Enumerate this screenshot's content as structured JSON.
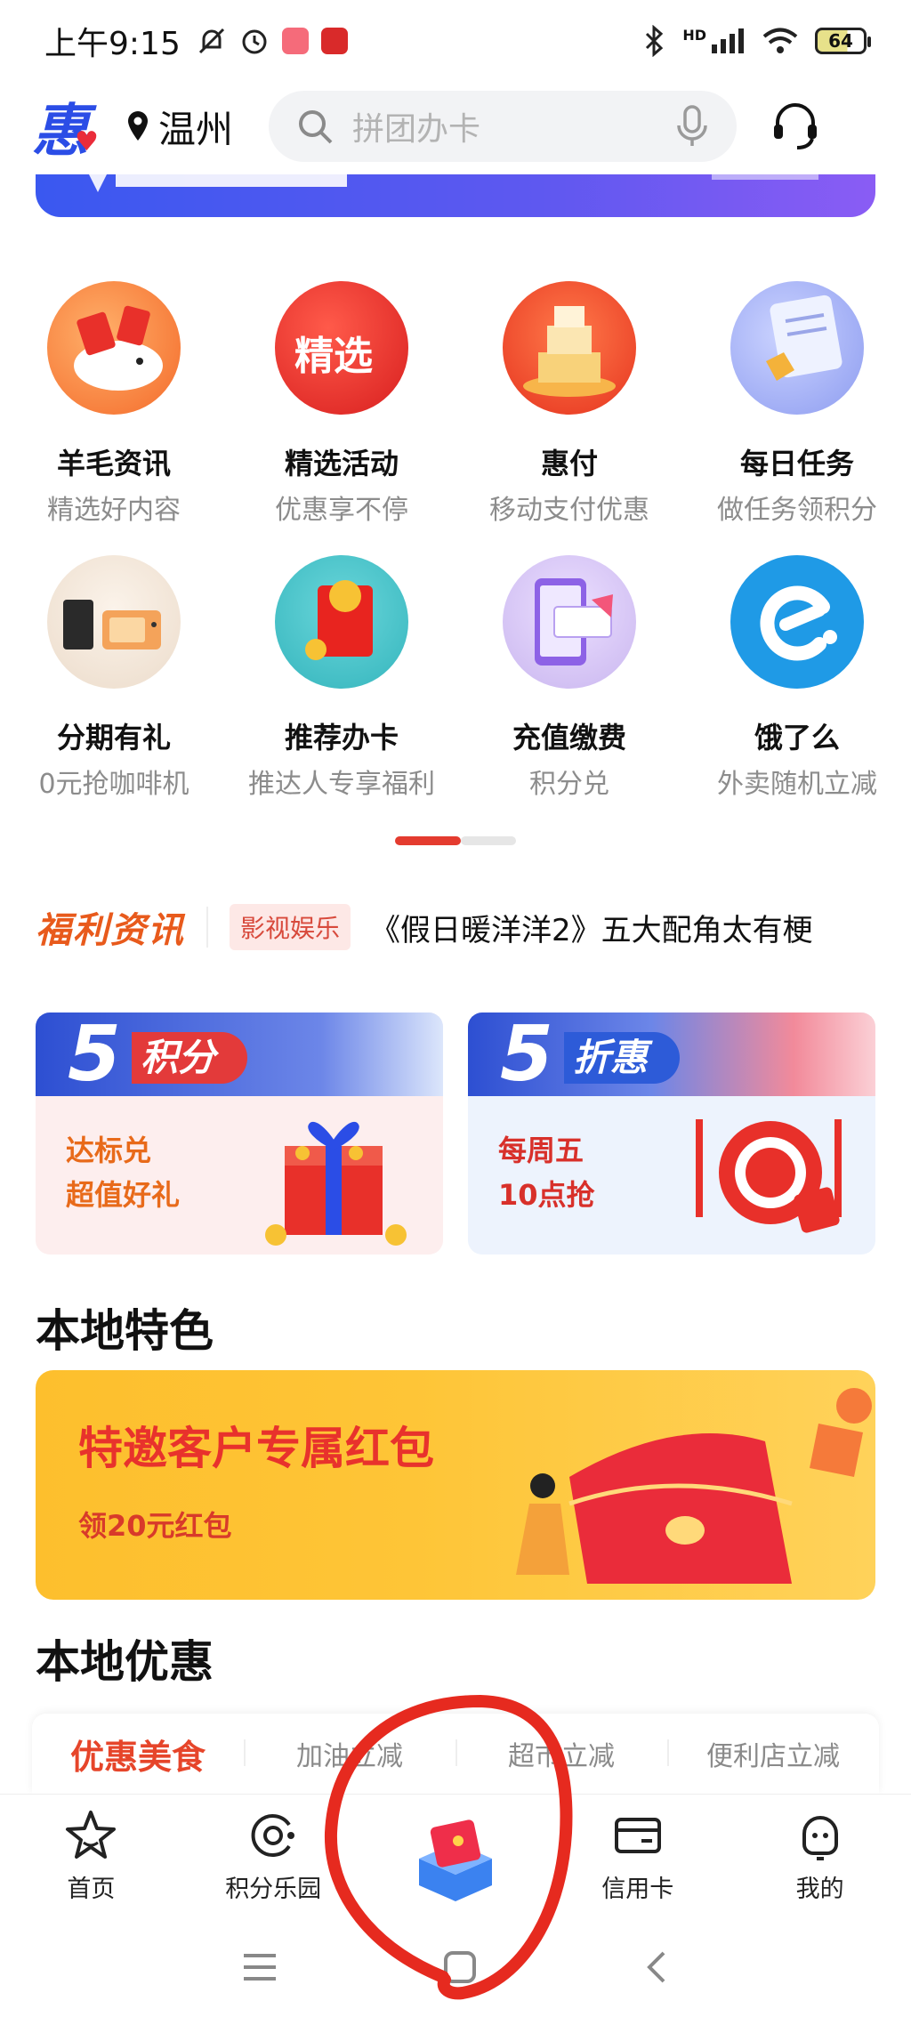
{
  "status_bar": {
    "time": "上午9:15",
    "battery": "64",
    "network": "HD"
  },
  "header": {
    "logo": "惠",
    "city": "温州",
    "search_placeholder": "拼团办卡"
  },
  "grid": [
    {
      "title": "羊毛资讯",
      "sub": "精选好内容",
      "icon": "red-envelope-cloud-icon",
      "bg": "#fb8a3c"
    },
    {
      "title": "精选活动",
      "sub": "优惠享不停",
      "icon": "featured-badge-icon",
      "bg": "#e8302a",
      "badge": "精选"
    },
    {
      "title": "惠付",
      "sub": "移动支付优惠",
      "icon": "gift-stack-icon",
      "bg": "#f25a2a"
    },
    {
      "title": "每日任务",
      "sub": "做任务领积分",
      "icon": "task-scroll-icon",
      "bg": "#8d9cf0"
    },
    {
      "title": "分期有礼",
      "sub": "0元抢咖啡机",
      "icon": "coffee-machine-icon",
      "bg": "#f1e6d8"
    },
    {
      "title": "推荐办卡",
      "sub": "推达人专享福利",
      "icon": "red-packet-coin-icon",
      "bg": "#45c1c8"
    },
    {
      "title": "充值缴费",
      "sub": "积分兑",
      "icon": "phone-voucher-icon",
      "bg": "#c9b6ef"
    },
    {
      "title": "饿了么",
      "sub": "外卖随机立减",
      "icon": "eleme-logo-icon",
      "bg": "#1f9ae6"
    }
  ],
  "news": {
    "brand": "福利资讯",
    "tag": "影视娱乐",
    "headline": "《假日暖洋洋2》五大配角太有梗"
  },
  "promos": [
    {
      "num": "5",
      "label": "积分",
      "line1": "达标兑",
      "line2": "超值好礼",
      "accent": "#e33a3a",
      "text_color": "#e86a1a"
    },
    {
      "num": "5",
      "label": "折惠",
      "line1": "每周五",
      "line2": "10点抢",
      "accent": "#2d5bd8",
      "text_color": "#d8302a"
    }
  ],
  "local_feature": {
    "title": "本地特色",
    "banner_title": "特邀客户专属红包",
    "banner_sub": "领20元红包"
  },
  "local_deals": {
    "title": "本地优惠",
    "tabs": [
      "优惠美食",
      "加油立减",
      "超市立减",
      "便利店立减"
    ]
  },
  "bottom_nav": [
    {
      "label": "首页",
      "icon": "star-icon"
    },
    {
      "label": "积分乐园",
      "icon": "points-icon"
    },
    {
      "label": "",
      "icon": "red-envelope-box-icon"
    },
    {
      "label": "信用卡",
      "icon": "card-icon"
    },
    {
      "label": "我的",
      "icon": "profile-icon"
    }
  ]
}
